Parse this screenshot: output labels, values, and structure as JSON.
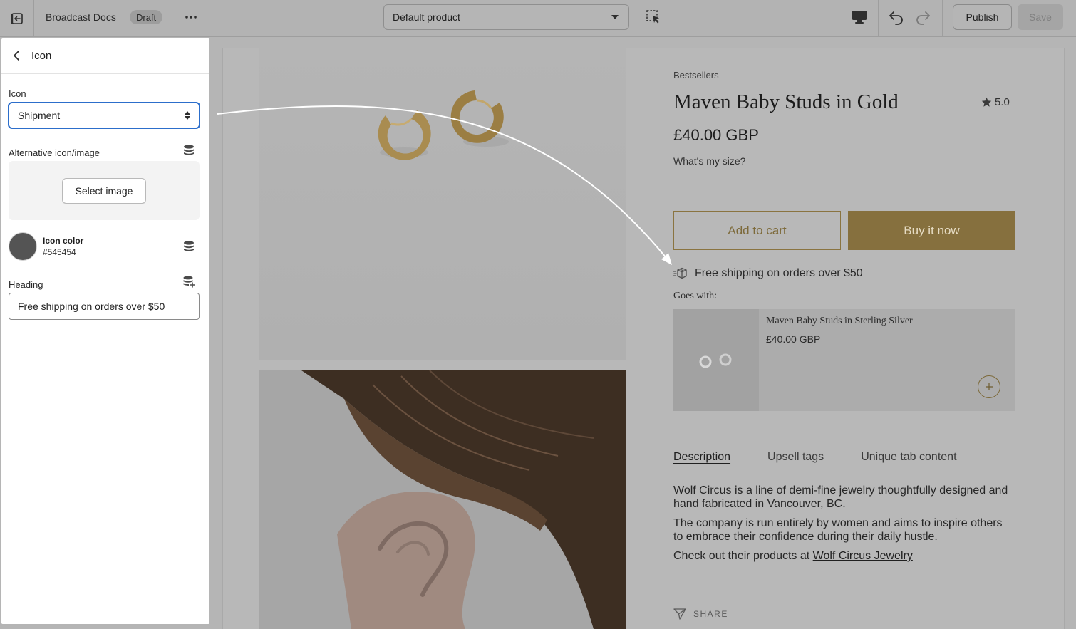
{
  "topbar": {
    "store_name": "Broadcast Docs",
    "status_badge": "Draft",
    "template_select": "Default product",
    "publish_label": "Publish",
    "save_label": "Save"
  },
  "panel": {
    "title": "Icon",
    "icon_label": "Icon",
    "icon_value": "Shipment",
    "alt_icon_label": "Alternative icon/image",
    "select_image_label": "Select image",
    "icon_color_label": "Icon color",
    "icon_color_hex": "#545454",
    "heading_label": "Heading",
    "heading_value": "Free shipping on orders over $50"
  },
  "product": {
    "vendor": "Bestsellers",
    "title": "Maven Baby Studs in Gold",
    "rating": "5.0",
    "price": "£40.00 GBP",
    "size_link": "What's my size?",
    "add_to_cart": "Add to cart",
    "buy_now": "Buy it now",
    "shipping_text": "Free shipping on orders over $50",
    "goes_with": "Goes with:",
    "upsell": {
      "name": "Maven Baby Studs in Sterling Silver",
      "price": "£40.00 GBP"
    },
    "tabs": [
      {
        "label": "Description"
      },
      {
        "label": "Upsell tags"
      },
      {
        "label": "Unique tab content"
      }
    ],
    "description": {
      "p1": "Wolf Circus is a line of demi-fine jewelry thoughtfully designed and hand fabricated in Vancouver, BC.",
      "p2": "The company is run entirely by women and aims to inspire others to embrace their confidence during their daily hustle.",
      "p3_prefix": "Check out their products at ",
      "p3_link": "Wolf Circus Jewelry"
    },
    "share_label": "SHARE"
  },
  "colors": {
    "accent_gold": "#86703e",
    "focus_blue": "#2c6ecb",
    "icon_color": "#545454"
  }
}
